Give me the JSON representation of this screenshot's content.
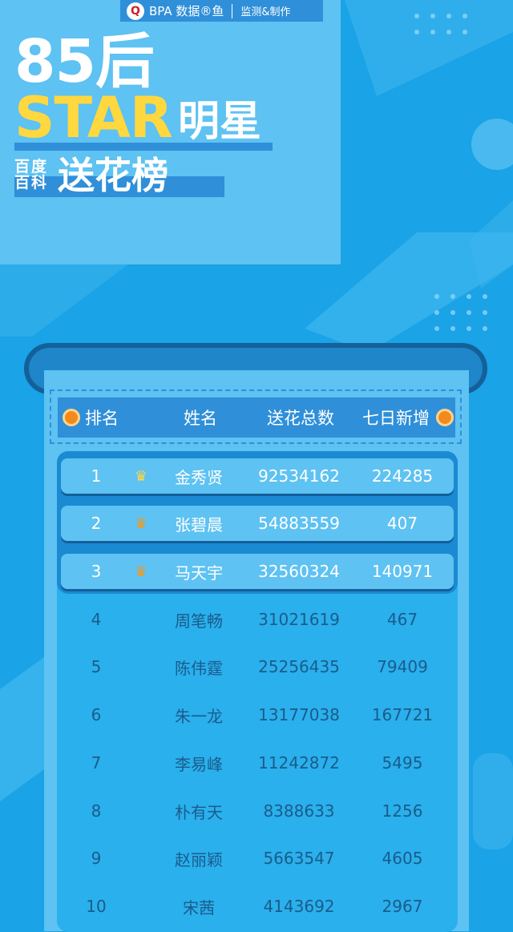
{
  "brand": {
    "logo_icon": "fish-icon",
    "name": "BPA 数据®鱼",
    "subtitle": "监测&制作"
  },
  "title": {
    "line1": "85后",
    "star": "STAR",
    "mingxing": "明星",
    "baike": "百度百科",
    "songhua": "送花榜"
  },
  "colors": {
    "background": "#1aa3e6",
    "accent_yellow": "#ffd83f",
    "header_blue": "#2f8fd9",
    "panel": "#5ec2f2"
  },
  "table": {
    "headers": [
      "排名",
      "姓名",
      "送花总数",
      "七日新增"
    ],
    "rows": [
      {
        "rank": "1",
        "crown": "♛",
        "name": "金秀贤",
        "total": "92534162",
        "new": "224285"
      },
      {
        "rank": "2",
        "crown": "♛",
        "name": "张碧晨",
        "total": "54883559",
        "new": "407"
      },
      {
        "rank": "3",
        "crown": "♛",
        "name": "马天宇",
        "total": "32560324",
        "new": "140971"
      },
      {
        "rank": "4",
        "crown": "",
        "name": "周笔畅",
        "total": "31021619",
        "new": "467"
      },
      {
        "rank": "5",
        "crown": "",
        "name": "陈伟霆",
        "total": "25256435",
        "new": "79409"
      },
      {
        "rank": "6",
        "crown": "",
        "name": "朱一龙",
        "total": "13177038",
        "new": "167721"
      },
      {
        "rank": "7",
        "crown": "",
        "name": "李易峰",
        "total": "11242872",
        "new": "5495"
      },
      {
        "rank": "8",
        "crown": "",
        "name": "朴有天",
        "total": "8388633",
        "new": "1256"
      },
      {
        "rank": "9",
        "crown": "",
        "name": "赵丽颖",
        "total": "5663547",
        "new": "4605"
      },
      {
        "rank": "10",
        "crown": "",
        "name": "宋茜",
        "total": "4143692",
        "new": "2967"
      }
    ]
  }
}
